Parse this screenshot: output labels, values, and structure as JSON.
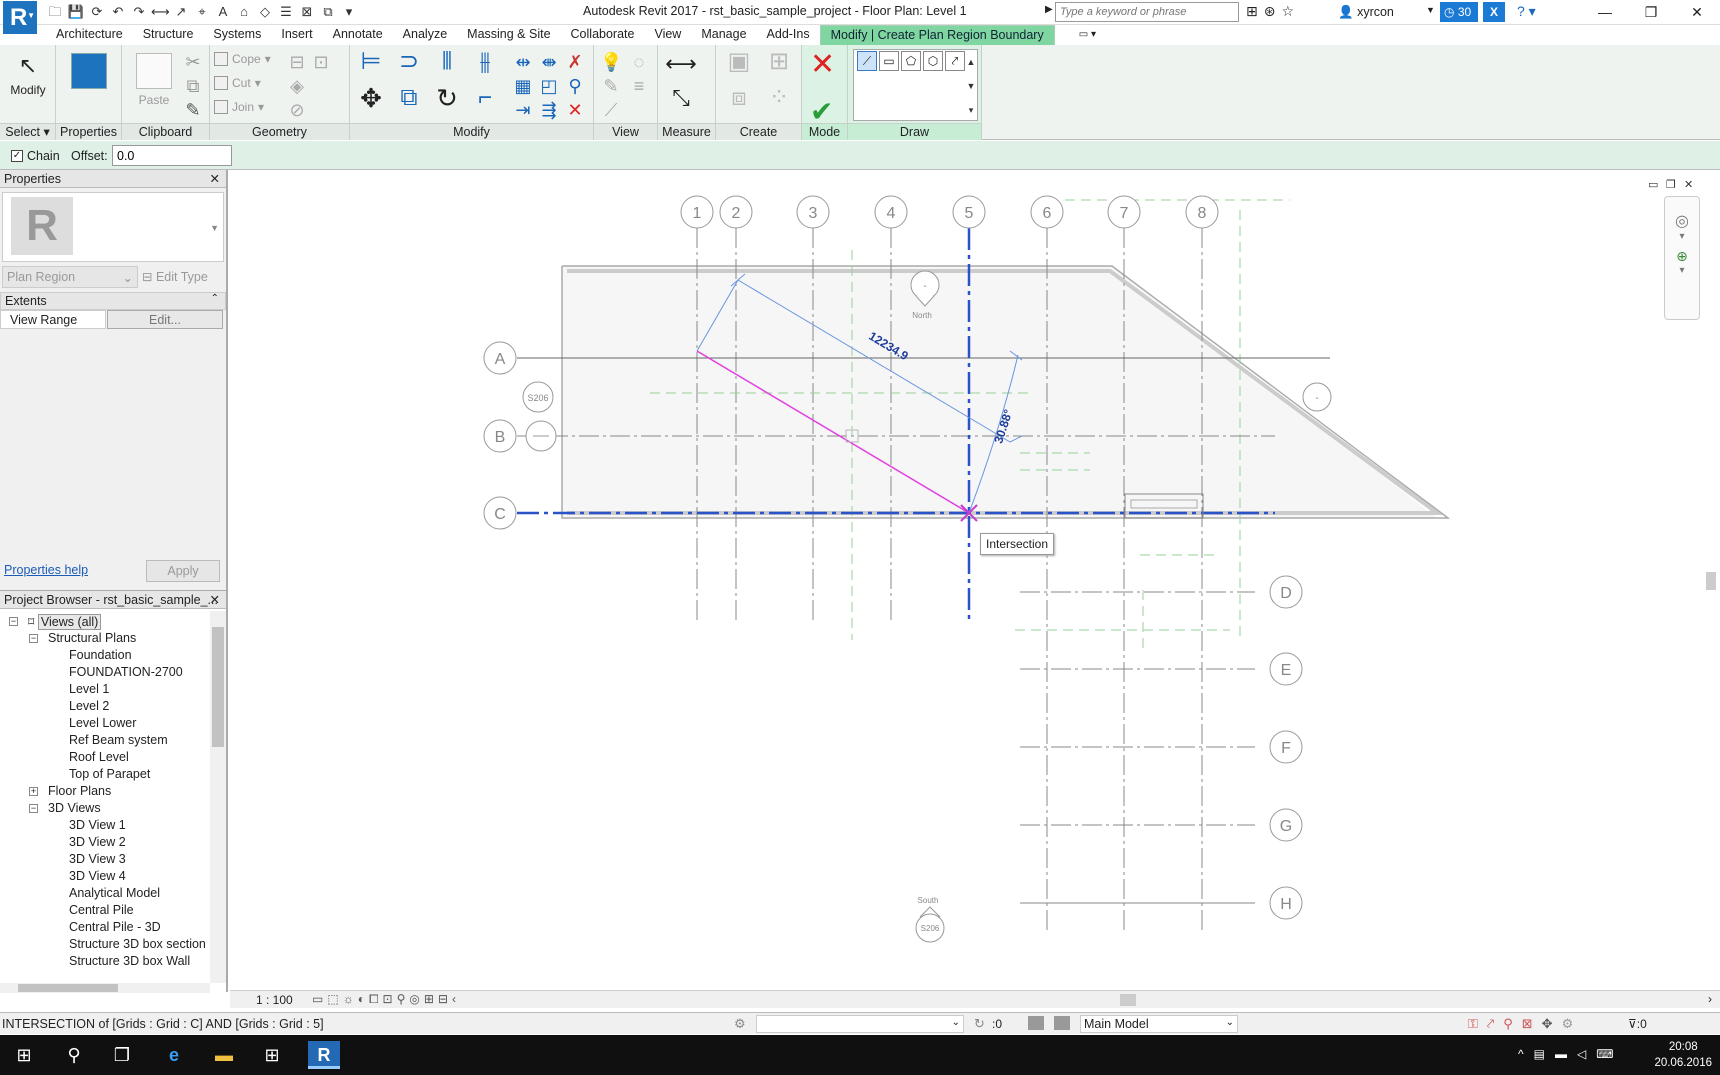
{
  "titlebar": {
    "app_title": "Autodesk Revit 2017 -    rst_basic_sample_project - Floor Plan: Level 1",
    "search_placeholder": "Type a keyword or phrase",
    "user": "xyrcon",
    "badge_count": "30"
  },
  "tabs": [
    "Architecture",
    "Structure",
    "Systems",
    "Insert",
    "Annotate",
    "Analyze",
    "Massing & Site",
    "Collaborate",
    "View",
    "Manage",
    "Add-Ins"
  ],
  "active_tab": "Modify | Create Plan Region Boundary",
  "ribbon": {
    "panels": [
      "Select",
      "Properties",
      "Clipboard",
      "Geometry",
      "Modify",
      "View",
      "Measure",
      "Create",
      "Mode",
      "Draw"
    ],
    "modify_label": "Modify",
    "paste_label": "Paste",
    "cope_label": "Cope",
    "cut_label": "Cut",
    "join_label": "Join"
  },
  "options_bar": {
    "chain_label": "Chain",
    "chain_checked": true,
    "offset_label": "Offset:",
    "offset_value": "0.0"
  },
  "properties": {
    "header": "Properties",
    "type": "Plan Region",
    "edit_type": "Edit Type",
    "section": "Extents",
    "param_name": "View Range",
    "param_value": "Edit...",
    "help": "Properties help",
    "apply": "Apply"
  },
  "browser": {
    "header": "Project Browser - rst_basic_sample_...",
    "root": "Views (all)",
    "groups": [
      {
        "label": "Structural Plans",
        "expanded": true,
        "items": [
          "Foundation",
          "FOUNDATION-2700",
          "Level 1",
          "Level 2",
          "Level Lower",
          "Ref Beam system",
          "Roof Level",
          "Top of Parapet"
        ]
      },
      {
        "label": "Floor Plans",
        "expanded": false,
        "items": []
      },
      {
        "label": "3D Views",
        "expanded": true,
        "items": [
          "3D View 1",
          "3D View 2",
          "3D View 3",
          "3D View 4",
          "Analytical Model",
          "Central Pile",
          "Central Pile - 3D",
          "Structure 3D box section",
          "Structure 3D box Wall"
        ]
      }
    ]
  },
  "drawing": {
    "vertical_grids": [
      "1",
      "2",
      "3",
      "4",
      "5",
      "6",
      "7",
      "8"
    ],
    "horizontal_grids": [
      "A",
      "B",
      "C"
    ],
    "right_grids": [
      "D",
      "E",
      "F",
      "G",
      "H"
    ],
    "dimension_text": "12234.9",
    "angle_text": "30.88°",
    "tooltip": "Intersection",
    "north_label": "North",
    "south_label": "South",
    "section_tag": "S206"
  },
  "view_control": {
    "scale": "1 : 100"
  },
  "status": {
    "message": "INTERSECTION  of [Grids : Grid : C] AND [Grids : Grid : 5]",
    "zero_count": ":0",
    "model": "Main Model",
    "filter_count": ":0"
  },
  "taskbar": {
    "time": "20:08",
    "date": "20.06.2016"
  },
  "colors": {
    "accent_green": "#7fd6a1",
    "sketch_magenta": "#e040e0",
    "grid_blue": "#2a52c9"
  }
}
